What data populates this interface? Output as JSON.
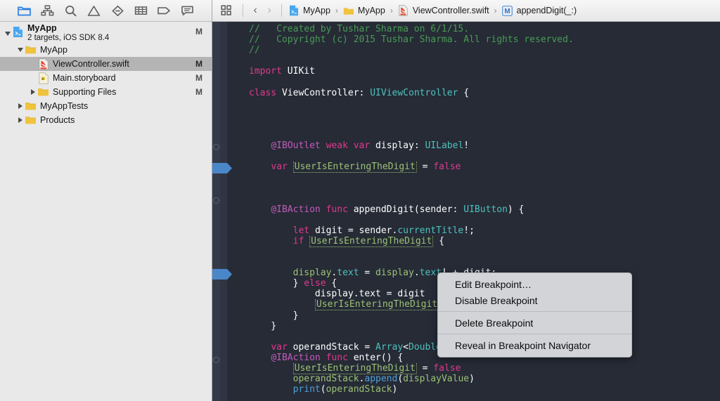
{
  "navigator": {
    "tabs": [
      {
        "name": "project-navigator-tab",
        "label": "Project",
        "icon": "folder-icon",
        "selected": true
      },
      {
        "name": "symbol-navigator-tab",
        "label": "Symbol",
        "icon": "hierarchy-icon",
        "selected": false
      },
      {
        "name": "find-navigator-tab",
        "label": "Find",
        "icon": "search-icon",
        "selected": false
      },
      {
        "name": "issue-navigator-tab",
        "label": "Issue",
        "icon": "warning-triangle-icon",
        "selected": false
      },
      {
        "name": "test-navigator-tab",
        "label": "Test",
        "icon": "diamond-minus-icon",
        "selected": false
      },
      {
        "name": "debug-navigator-tab",
        "label": "Debug",
        "icon": "list-lines-icon",
        "selected": false
      },
      {
        "name": "breakpoint-navigator-tab",
        "label": "Breakpoint",
        "icon": "tag-icon",
        "selected": false
      },
      {
        "name": "report-navigator-tab",
        "label": "Report",
        "icon": "speech-bubble-icon",
        "selected": false
      }
    ],
    "tree": [
      {
        "title": "MyApp",
        "subtitle": "2 targets, iOS SDK 8.4",
        "status": "M",
        "icon": "xcode-project-icon",
        "indent": 0,
        "disclosure": "down",
        "bold": true,
        "selected": false
      },
      {
        "title": "MyApp",
        "subtitle": "",
        "status": "",
        "icon": "folder-yellow-icon",
        "indent": 1,
        "disclosure": "down",
        "bold": false,
        "selected": false
      },
      {
        "title": "ViewController.swift",
        "subtitle": "",
        "status": "M",
        "icon": "swift-file-icon",
        "indent": 2,
        "disclosure": "none",
        "bold": false,
        "selected": true
      },
      {
        "title": "Main.storyboard",
        "subtitle": "",
        "status": "M",
        "icon": "storyboard-file-icon",
        "indent": 2,
        "disclosure": "none",
        "bold": false,
        "selected": false
      },
      {
        "title": "Supporting Files",
        "subtitle": "",
        "status": "M",
        "icon": "folder-yellow-icon",
        "indent": 2,
        "disclosure": "right",
        "bold": false,
        "selected": false
      },
      {
        "title": "MyAppTests",
        "subtitle": "",
        "status": "",
        "icon": "folder-yellow-icon",
        "indent": 1,
        "disclosure": "right",
        "bold": false,
        "selected": false
      },
      {
        "title": "Products",
        "subtitle": "",
        "status": "",
        "icon": "folder-yellow-icon",
        "indent": 1,
        "disclosure": "right",
        "bold": false,
        "selected": false
      }
    ]
  },
  "jump_bar": {
    "related_items_icon": "related-items-icon",
    "back_label": "‹",
    "forward_label": "›",
    "breadcrumbs": [
      {
        "label": "MyApp",
        "icon": "xcode-project-icon"
      },
      {
        "label": "MyApp",
        "icon": "folder-yellow-icon"
      },
      {
        "label": "ViewController.swift",
        "icon": "swift-file-icon"
      },
      {
        "label": "appendDigit(_:)",
        "icon": "method-m-badge-icon"
      }
    ],
    "separator": "›"
  },
  "editor": {
    "theme": {
      "background": "#262b36",
      "gutter": "#343a47",
      "comment": "#4a9b55",
      "keyword": "#e2388f",
      "type": "#4ec2bd",
      "attribute": "#c35abc",
      "identifier": "#9cc275",
      "call": "#4fa0d8",
      "plain": "#ffffff",
      "breakpoint": "#4a87c9"
    },
    "code_lines": [
      {
        "segments": [
          {
            "t": "//   Created by Tushar Sharma on 6/1/15.",
            "c": "cmt"
          }
        ]
      },
      {
        "segments": [
          {
            "t": "//   Copyright (c) 2015 Tushar Sharma. All rights reserved.",
            "c": "cmt"
          }
        ]
      },
      {
        "segments": [
          {
            "t": "//",
            "c": "cmt"
          }
        ]
      },
      {
        "segments": []
      },
      {
        "segments": [
          {
            "t": "import ",
            "c": "kw"
          },
          {
            "t": "UIKit",
            "c": "plain"
          }
        ]
      },
      {
        "segments": []
      },
      {
        "segments": [
          {
            "t": "class ",
            "c": "kw"
          },
          {
            "t": "ViewController: ",
            "c": "plain"
          },
          {
            "t": "UIViewController",
            "c": "type"
          },
          {
            "t": " {",
            "c": "plain"
          }
        ]
      },
      {
        "segments": []
      },
      {
        "segments": []
      },
      {
        "segments": []
      },
      {
        "segments": []
      },
      {
        "segments": [
          {
            "t": "    ",
            "c": "plain"
          },
          {
            "t": "@IBOutlet ",
            "c": "attr"
          },
          {
            "t": "weak ",
            "c": "kw"
          },
          {
            "t": "var ",
            "c": "kw"
          },
          {
            "t": "display: ",
            "c": "plain"
          },
          {
            "t": "UILabel",
            "c": "type"
          },
          {
            "t": "!",
            "c": "plain"
          }
        ]
      },
      {
        "segments": []
      },
      {
        "segments": [
          {
            "t": "    ",
            "c": "plain"
          },
          {
            "t": "var ",
            "c": "kw"
          },
          {
            "t": "UserIsEnteringTheDigit",
            "c": "var-pill"
          },
          {
            "t": " = ",
            "c": "plain"
          },
          {
            "t": "false",
            "c": "kw"
          }
        ]
      },
      {
        "segments": []
      },
      {
        "segments": []
      },
      {
        "segments": []
      },
      {
        "segments": [
          {
            "t": "    ",
            "c": "plain"
          },
          {
            "t": "@IBAction ",
            "c": "attr"
          },
          {
            "t": "func ",
            "c": "kw"
          },
          {
            "t": "appendDigit(sender: ",
            "c": "plain"
          },
          {
            "t": "UIButton",
            "c": "type"
          },
          {
            "t": ") {",
            "c": "plain"
          }
        ]
      },
      {
        "segments": []
      },
      {
        "segments": [
          {
            "t": "        ",
            "c": "plain"
          },
          {
            "t": "let ",
            "c": "kw"
          },
          {
            "t": "digit = sender.",
            "c": "plain"
          },
          {
            "t": "currentTitle",
            "c": "type"
          },
          {
            "t": "!;",
            "c": "plain"
          }
        ]
      },
      {
        "segments": [
          {
            "t": "        ",
            "c": "plain"
          },
          {
            "t": "if ",
            "c": "kw"
          },
          {
            "t": "UserIsEnteringTheDigit",
            "c": "var-pill"
          },
          {
            "t": " {",
            "c": "plain"
          }
        ]
      },
      {
        "segments": []
      },
      {
        "segments": []
      },
      {
        "segments": [
          {
            "t": "        ",
            "c": "plain"
          },
          {
            "t": "display",
            "c": "ident"
          },
          {
            "t": ".",
            "c": "plain"
          },
          {
            "t": "text",
            "c": "prop"
          },
          {
            "t": " = ",
            "c": "plain"
          },
          {
            "t": "display",
            "c": "ident"
          },
          {
            "t": ".",
            "c": "plain"
          },
          {
            "t": "text",
            "c": "prop"
          },
          {
            "t": "! + digit;",
            "c": "plain"
          }
        ]
      },
      {
        "segments": [
          {
            "t": "        } ",
            "c": "plain"
          },
          {
            "t": "else",
            "c": "kw"
          },
          {
            "t": " {",
            "c": "plain"
          }
        ]
      },
      {
        "segments": [
          {
            "t": "            display.text = digit",
            "c": "plain"
          }
        ]
      },
      {
        "segments": [
          {
            "t": "            ",
            "c": "plain"
          },
          {
            "t": "UserIsEnteringTheDigit",
            "c": "var-pill"
          },
          {
            "t": " = ",
            "c": "plain"
          },
          {
            "t": "true",
            "c": "kw"
          }
        ]
      },
      {
        "segments": [
          {
            "t": "        }",
            "c": "plain"
          }
        ]
      },
      {
        "segments": [
          {
            "t": "    }",
            "c": "plain"
          }
        ]
      },
      {
        "segments": []
      },
      {
        "segments": [
          {
            "t": "    ",
            "c": "plain"
          },
          {
            "t": "var ",
            "c": "kw"
          },
          {
            "t": "operandStack = ",
            "c": "plain"
          },
          {
            "t": "Array",
            "c": "type"
          },
          {
            "t": "<",
            "c": "plain"
          },
          {
            "t": "Double",
            "c": "type"
          },
          {
            "t": ">()",
            "c": "plain"
          }
        ]
      },
      {
        "segments": [
          {
            "t": "    ",
            "c": "plain"
          },
          {
            "t": "@IBAction ",
            "c": "attr"
          },
          {
            "t": "func ",
            "c": "kw"
          },
          {
            "t": "enter() {",
            "c": "plain"
          }
        ]
      },
      {
        "segments": [
          {
            "t": "        ",
            "c": "plain"
          },
          {
            "t": "UserIsEnteringTheDigit",
            "c": "var-pill"
          },
          {
            "t": " = ",
            "c": "plain"
          },
          {
            "t": "false",
            "c": "kw"
          }
        ]
      },
      {
        "segments": [
          {
            "t": "        ",
            "c": "plain"
          },
          {
            "t": "operandStack",
            "c": "ident"
          },
          {
            "t": ".",
            "c": "plain"
          },
          {
            "t": "append",
            "c": "call"
          },
          {
            "t": "(",
            "c": "plain"
          },
          {
            "t": "displayValue",
            "c": "ident"
          },
          {
            "t": ")",
            "c": "plain"
          }
        ]
      },
      {
        "segments": [
          {
            "t": "        ",
            "c": "plain"
          },
          {
            "t": "print",
            "c": "call"
          },
          {
            "t": "(",
            "c": "plain"
          },
          {
            "t": "operandStack",
            "c": "ident"
          },
          {
            "t": ")",
            "c": "plain"
          }
        ]
      }
    ],
    "fold_dots": [
      206,
      282,
      509
    ],
    "breakpoints": [
      232,
      383
    ]
  },
  "context_menu": {
    "groups": [
      {
        "items": [
          {
            "label": "Edit Breakpoint…",
            "name": "menu-edit-breakpoint"
          },
          {
            "label": "Disable Breakpoint",
            "name": "menu-disable-breakpoint"
          }
        ]
      },
      {
        "items": [
          {
            "label": "Delete Breakpoint",
            "name": "menu-delete-breakpoint"
          }
        ]
      },
      {
        "items": [
          {
            "label": "Reveal in Breakpoint Navigator",
            "name": "menu-reveal-in-breakpoint-navigator"
          }
        ]
      }
    ]
  }
}
